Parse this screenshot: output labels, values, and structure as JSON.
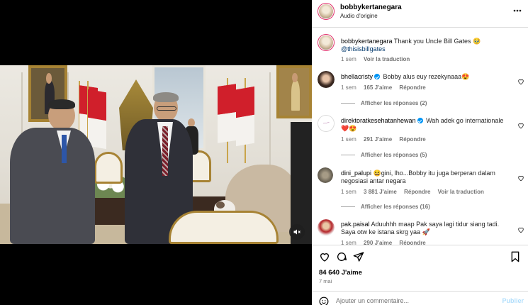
{
  "post": {
    "username": "bobbykertanegara",
    "audio": "Audio d'origine",
    "caption_user": "bobbykertanegara",
    "caption_text": "Thank you Uncle Bill Gates 🥹",
    "caption_mention": "@thisisbillgates",
    "caption_time": "1 sem",
    "caption_translate": "Voir la traduction",
    "likes": "84 640 J'aime",
    "date": "7 mai"
  },
  "comments": [
    {
      "user": "bhellacristy",
      "verified": true,
      "text": "Bobby alus euy rezekynaaa😍",
      "time": "1 sem",
      "likes": "165 J'aime",
      "reply": "Répondre",
      "translate": "",
      "replies": "Afficher les réponses (2)"
    },
    {
      "user": "direktoratkesehatanhewan",
      "verified": true,
      "text": "Wah adek go internationale❤️😍",
      "time": "1 sem",
      "likes": "291 J'aime",
      "reply": "Répondre",
      "translate": "",
      "replies": "Afficher les réponses (5)"
    },
    {
      "user": "dini_palupi",
      "verified": false,
      "text": "😆gini, lho...Bobby itu juga berperan dalam negosiasi antar negara",
      "time": "1 sem",
      "likes": "3 881 J'aime",
      "reply": "Répondre",
      "translate": "Voir la traduction",
      "replies": "Afficher les réponses (16)"
    },
    {
      "user": "pak.paisal",
      "verified": false,
      "text": "Aduuhhh maap Pak saya lagi tidur siang tadi. Saya otw ke istana skrg yaa 🚀",
      "time": "1 sem",
      "likes": "290 J'aime",
      "reply": "Répondre",
      "translate": "",
      "replies": ""
    }
  ],
  "comment_box": {
    "placeholder": "Ajouter un commentaire...",
    "post_label": "Publier"
  },
  "icons": {
    "more": "more-horizontal-icon",
    "like": "heart-icon",
    "comment": "comment-icon",
    "share": "send-icon",
    "save": "bookmark-icon",
    "emoji": "emoji-icon",
    "mute": "speaker-muted-icon"
  },
  "colors": {
    "link": "#00376b",
    "verified": "#0095f6",
    "muted_text": "#737373",
    "post_button_disabled": "#b2dffc"
  }
}
